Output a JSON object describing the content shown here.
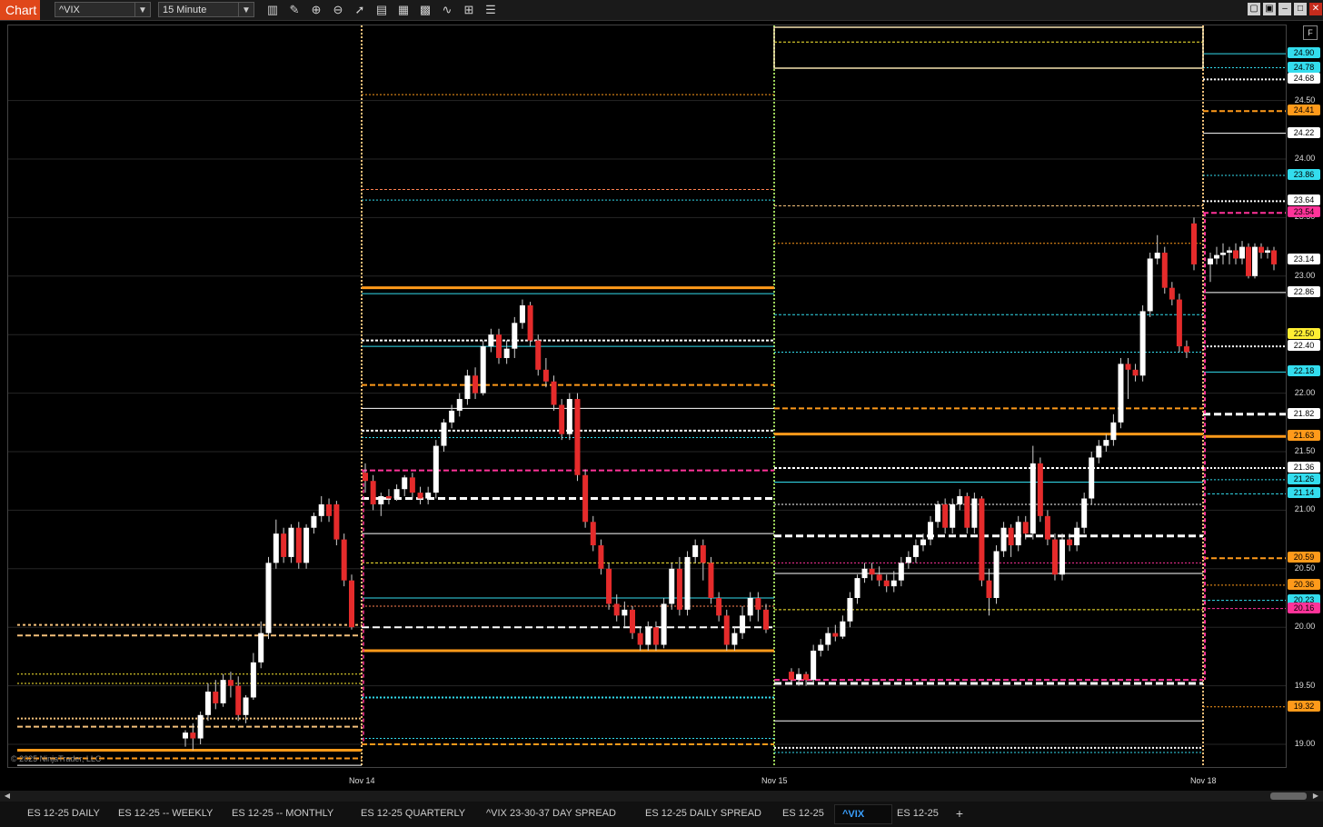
{
  "titlebar": {
    "app_label": "Chart",
    "instrument": "^VIX",
    "interval": "15 Minute"
  },
  "toolbar_icons": [
    "bars-type-icon",
    "pencil-icon",
    "zoom-in-icon",
    "zoom-out-icon",
    "pointer-icon",
    "properties-icon",
    "template-icon",
    "data-box-icon",
    "indicators-icon",
    "strategy-icon",
    "more-icon"
  ],
  "window_buttons": [
    "restore-icon",
    "tile-icon",
    "minimize-icon",
    "maximize-icon",
    "close-icon"
  ],
  "price_axis": {
    "ticks": [
      "24.50",
      "24.00",
      "23.50",
      "23.00",
      "22.50",
      "22.00",
      "21.50",
      "21.00",
      "20.50",
      "20.00",
      "19.50",
      "19.00"
    ],
    "labels": [
      {
        "v": "24.90",
        "color": "#33ddee"
      },
      {
        "v": "24.78",
        "color": "#33ddee"
      },
      {
        "v": "24.68",
        "color": "#ffffff"
      },
      {
        "v": "24.41",
        "color": "#ff9a1a"
      },
      {
        "v": "24.22",
        "color": "#ffffff"
      },
      {
        "v": "23.86",
        "color": "#33ddee"
      },
      {
        "v": "23.64",
        "color": "#ffffff"
      },
      {
        "v": "23.54",
        "color": "#ff3399"
      },
      {
        "v": "23.14",
        "color": "#ffffff"
      },
      {
        "v": "22.86",
        "color": "#ffffff"
      },
      {
        "v": "22.50",
        "color": "#ffee33"
      },
      {
        "v": "22.40",
        "color": "#ffffff"
      },
      {
        "v": "22.18",
        "color": "#33ddee"
      },
      {
        "v": "21.82",
        "color": "#ffffff"
      },
      {
        "v": "21.63",
        "color": "#ff9a1a"
      },
      {
        "v": "21.36",
        "color": "#ffffff"
      },
      {
        "v": "21.26",
        "color": "#33ddee"
      },
      {
        "v": "21.14",
        "color": "#33ddee"
      },
      {
        "v": "20.59",
        "color": "#ff9a1a"
      },
      {
        "v": "20.36",
        "color": "#ff9a1a"
      },
      {
        "v": "20.23",
        "color": "#33ddee"
      },
      {
        "v": "20.16",
        "color": "#ff3399"
      },
      {
        "v": "19.32",
        "color": "#ff9a1a"
      }
    ],
    "f_button": "F"
  },
  "time_axis": [
    "Nov 14",
    "Nov 15",
    "Nov 18"
  ],
  "copyright": "© 2025 NinjaTrader, LLC",
  "tabs": [
    {
      "label": "ES 12-25 DAILY",
      "active": false
    },
    {
      "label": "ES 12-25 -- WEEKLY",
      "active": false
    },
    {
      "label": "ES 12-25 -- MONTHLY",
      "active": false
    },
    {
      "label": "ES 12-25 QUARTERLY",
      "active": false
    },
    {
      "label": "^VIX 23-30-37 DAY SPREAD",
      "active": false
    },
    {
      "label": "ES 12-25 DAILY SPREAD",
      "active": false
    },
    {
      "label": "ES 12-25",
      "active": false
    },
    {
      "label": "^VIX",
      "active": true
    },
    {
      "label": "ES 12-25",
      "active": false
    }
  ],
  "chart_data": {
    "type": "candlestick",
    "title": "",
    "ylim": [
      18.95,
      25.05
    ],
    "ylabel": "",
    "xlabel": "",
    "session_breaks": [
      "Nov 14",
      "Nov 15",
      "Nov 18"
    ],
    "candles": [
      [
        19.05,
        19.1,
        18.98,
        19.12
      ],
      [
        19.1,
        19.05,
        18.95,
        19.18
      ],
      [
        19.05,
        19.25,
        19.0,
        19.28
      ],
      [
        19.25,
        19.45,
        19.2,
        19.52
      ],
      [
        19.45,
        19.35,
        19.3,
        19.55
      ],
      [
        19.35,
        19.55,
        19.32,
        19.6
      ],
      [
        19.55,
        19.5,
        19.4,
        19.62
      ],
      [
        19.5,
        19.25,
        19.2,
        19.58
      ],
      [
        19.25,
        19.4,
        19.18,
        19.42
      ],
      [
        19.4,
        19.7,
        19.38,
        19.78
      ],
      [
        19.7,
        19.95,
        19.65,
        20.05
      ],
      [
        19.95,
        20.55,
        19.9,
        20.6
      ],
      [
        20.55,
        20.8,
        20.5,
        20.92
      ],
      [
        20.8,
        20.6,
        20.55,
        20.85
      ],
      [
        20.6,
        20.85,
        20.55,
        20.88
      ],
      [
        20.85,
        20.55,
        20.5,
        20.9
      ],
      [
        20.55,
        20.85,
        20.5,
        20.88
      ],
      [
        20.85,
        20.95,
        20.8,
        20.98
      ],
      [
        20.95,
        21.05,
        20.9,
        21.12
      ],
      [
        21.05,
        20.95,
        20.9,
        21.1
      ],
      [
        21.05,
        20.75,
        20.7,
        21.08
      ],
      [
        20.75,
        20.4,
        20.35,
        20.8
      ],
      [
        20.4,
        20.0,
        19.98,
        20.45
      ],
      [
        21.32,
        21.25,
        21.15,
        21.4
      ],
      [
        21.25,
        21.05,
        21.0,
        21.3
      ],
      [
        21.05,
        21.12,
        20.95,
        21.15
      ],
      [
        21.12,
        21.1,
        21.05,
        21.18
      ],
      [
        21.1,
        21.18,
        21.08,
        21.22
      ],
      [
        21.18,
        21.28,
        21.12,
        21.3
      ],
      [
        21.28,
        21.15,
        21.1,
        21.32
      ],
      [
        21.15,
        21.1,
        21.05,
        21.2
      ],
      [
        21.1,
        21.15,
        21.05,
        21.2
      ],
      [
        21.15,
        21.55,
        21.1,
        21.6
      ],
      [
        21.55,
        21.75,
        21.5,
        21.78
      ],
      [
        21.75,
        21.85,
        21.7,
        21.9
      ],
      [
        21.85,
        21.95,
        21.8,
        22.0
      ],
      [
        21.95,
        22.15,
        21.9,
        22.2
      ],
      [
        22.15,
        22.0,
        21.95,
        22.22
      ],
      [
        22.0,
        22.4,
        21.98,
        22.45
      ],
      [
        22.4,
        22.5,
        22.35,
        22.55
      ],
      [
        22.5,
        22.3,
        22.25,
        22.55
      ],
      [
        22.3,
        22.38,
        22.25,
        22.45
      ],
      [
        22.38,
        22.6,
        22.3,
        22.65
      ],
      [
        22.6,
        22.75,
        22.55,
        22.8
      ],
      [
        22.75,
        22.45,
        22.4,
        22.78
      ],
      [
        22.45,
        22.2,
        22.15,
        22.5
      ],
      [
        22.2,
        22.1,
        22.05,
        22.3
      ],
      [
        22.1,
        21.9,
        21.85,
        22.15
      ],
      [
        21.9,
        21.65,
        21.6,
        21.95
      ],
      [
        21.65,
        21.95,
        21.6,
        22.0
      ],
      [
        21.95,
        21.3,
        21.25,
        22.0
      ],
      [
        21.3,
        20.9,
        20.85,
        21.35
      ],
      [
        20.9,
        20.7,
        20.65,
        20.95
      ],
      [
        20.7,
        20.5,
        20.45,
        20.75
      ],
      [
        20.5,
        20.2,
        20.15,
        20.55
      ],
      [
        20.2,
        20.1,
        20.05,
        20.28
      ],
      [
        20.1,
        20.15,
        20.0,
        20.22
      ],
      [
        20.15,
        19.95,
        19.9,
        20.18
      ],
      [
        19.95,
        19.85,
        19.8,
        20.0
      ],
      [
        19.85,
        20.0,
        19.8,
        20.05
      ],
      [
        20.0,
        19.85,
        19.8,
        20.05
      ],
      [
        19.85,
        20.2,
        19.82,
        20.25
      ],
      [
        20.2,
        20.5,
        20.15,
        20.55
      ],
      [
        20.5,
        20.15,
        20.1,
        20.6
      ],
      [
        20.15,
        20.6,
        20.1,
        20.65
      ],
      [
        20.6,
        20.7,
        20.55,
        20.75
      ],
      [
        20.7,
        20.55,
        20.4,
        20.75
      ],
      [
        20.55,
        20.25,
        20.2,
        20.6
      ],
      [
        20.25,
        20.1,
        20.05,
        20.3
      ],
      [
        20.1,
        19.85,
        19.8,
        20.15
      ],
      [
        19.85,
        19.95,
        19.8,
        20.0
      ],
      [
        19.95,
        20.1,
        19.9,
        20.18
      ],
      [
        20.1,
        20.25,
        20.05,
        20.3
      ],
      [
        20.25,
        20.15,
        20.05,
        20.3
      ],
      [
        20.15,
        19.98,
        19.95,
        20.2
      ],
      [
        19.62,
        19.55,
        19.52,
        19.65
      ],
      [
        19.55,
        19.6,
        19.5,
        19.65
      ],
      [
        19.6,
        19.55,
        19.5,
        19.62
      ],
      [
        19.55,
        19.8,
        19.52,
        19.85
      ],
      [
        19.8,
        19.85,
        19.75,
        19.9
      ],
      [
        19.85,
        19.95,
        19.8,
        20.0
      ],
      [
        19.95,
        19.92,
        19.88,
        20.02
      ],
      [
        19.92,
        20.05,
        19.9,
        20.1
      ],
      [
        20.05,
        20.25,
        20.0,
        20.3
      ],
      [
        20.25,
        20.42,
        20.2,
        20.45
      ],
      [
        20.42,
        20.5,
        20.38,
        20.55
      ],
      [
        20.5,
        20.45,
        20.4,
        20.55
      ],
      [
        20.45,
        20.4,
        20.35,
        20.52
      ],
      [
        20.4,
        20.35,
        20.3,
        20.45
      ],
      [
        20.35,
        20.4,
        20.3,
        20.48
      ],
      [
        20.4,
        20.55,
        20.35,
        20.6
      ],
      [
        20.55,
        20.6,
        20.5,
        20.65
      ],
      [
        20.6,
        20.7,
        20.55,
        20.75
      ],
      [
        20.7,
        20.75,
        20.65,
        20.8
      ],
      [
        20.75,
        20.9,
        20.7,
        20.95
      ],
      [
        20.9,
        21.05,
        20.85,
        21.08
      ],
      [
        21.05,
        20.85,
        20.8,
        21.1
      ],
      [
        20.85,
        21.05,
        20.8,
        21.1
      ],
      [
        21.05,
        21.12,
        21.0,
        21.18
      ],
      [
        21.12,
        20.85,
        20.8,
        21.15
      ],
      [
        20.85,
        21.1,
        20.8,
        21.15
      ],
      [
        21.1,
        20.4,
        20.35,
        21.12
      ],
      [
        20.4,
        20.25,
        20.1,
        20.5
      ],
      [
        20.25,
        20.65,
        20.2,
        20.7
      ],
      [
        20.65,
        20.85,
        20.6,
        20.9
      ],
      [
        20.85,
        20.7,
        20.6,
        20.88
      ],
      [
        20.7,
        20.9,
        20.65,
        20.95
      ],
      [
        20.9,
        20.8,
        20.75,
        20.95
      ],
      [
        20.8,
        21.4,
        20.75,
        21.55
      ],
      [
        21.4,
        20.95,
        20.9,
        21.45
      ],
      [
        20.95,
        20.75,
        20.7,
        21.0
      ],
      [
        20.75,
        20.45,
        20.4,
        20.8
      ],
      [
        20.45,
        20.75,
        20.4,
        20.8
      ],
      [
        20.75,
        20.7,
        20.65,
        20.8
      ],
      [
        20.7,
        20.85,
        20.65,
        20.9
      ],
      [
        20.85,
        21.1,
        20.8,
        21.15
      ],
      [
        21.1,
        21.45,
        21.05,
        21.5
      ],
      [
        21.45,
        21.55,
        21.4,
        21.6
      ],
      [
        21.55,
        21.6,
        21.5,
        21.65
      ],
      [
        21.6,
        21.75,
        21.55,
        21.82
      ],
      [
        21.75,
        22.25,
        21.7,
        22.3
      ],
      [
        22.25,
        22.2,
        21.95,
        22.3
      ],
      [
        22.2,
        22.15,
        22.1,
        22.25
      ],
      [
        22.15,
        22.7,
        22.1,
        22.75
      ],
      [
        22.7,
        23.15,
        22.65,
        23.2
      ],
      [
        23.15,
        23.2,
        23.1,
        23.35
      ],
      [
        23.2,
        22.9,
        22.85,
        23.25
      ],
      [
        22.9,
        22.8,
        22.75,
        22.95
      ],
      [
        22.8,
        22.4,
        22.35,
        22.85
      ],
      [
        22.4,
        22.35,
        22.3,
        22.45
      ],
      [
        23.45,
        23.1,
        23.05,
        23.5
      ],
      [
        23.1,
        23.15,
        22.95,
        23.2
      ],
      [
        23.15,
        23.18,
        23.1,
        23.25
      ],
      [
        23.18,
        23.2,
        23.1,
        23.28
      ],
      [
        23.2,
        23.22,
        23.1,
        23.25
      ],
      [
        23.22,
        23.15,
        23.1,
        23.28
      ],
      [
        23.15,
        23.25,
        23.1,
        23.3
      ],
      [
        23.25,
        23.0,
        22.98,
        23.28
      ],
      [
        23.0,
        23.25,
        22.98,
        23.28
      ],
      [
        23.25,
        23.2,
        23.15,
        23.28
      ],
      [
        23.2,
        23.22,
        23.15,
        23.25
      ],
      [
        23.22,
        23.1,
        23.05,
        23.25
      ]
    ]
  }
}
